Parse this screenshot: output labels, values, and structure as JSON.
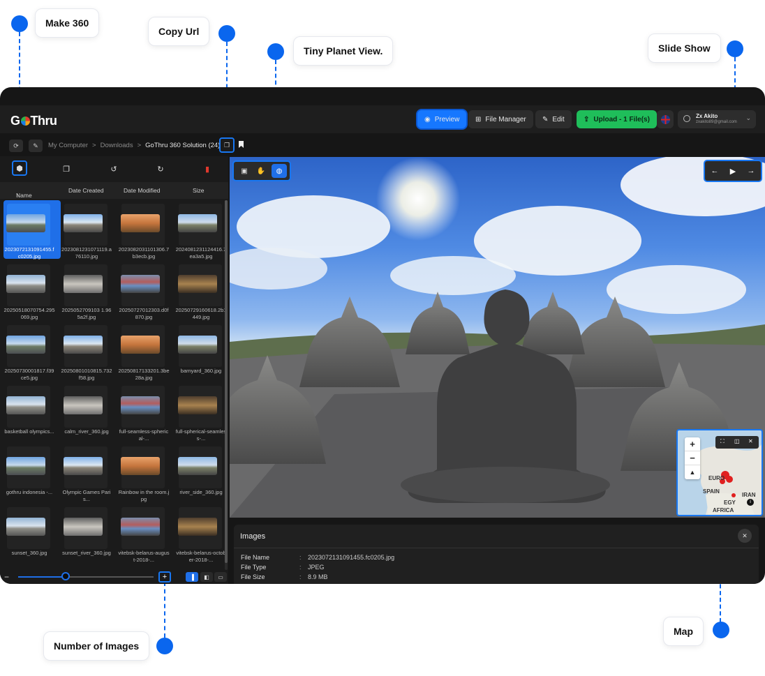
{
  "callouts": {
    "make360": "Make 360",
    "copy_url": "Copy Url",
    "tiny_planet": "Tiny Planet View.",
    "slide_show": "Slide Show",
    "number_of_images": "Number of Images",
    "map": "Map"
  },
  "app": {
    "logo": "GoThru",
    "header": {
      "preview": "Preview",
      "file_manager": "File Manager",
      "edit": "Edit",
      "upload": "Upload - 1 File(s)",
      "user_name": "Zx Akito",
      "user_email": "zxakito89@gmail.com"
    },
    "breadcrumb": {
      "items": [
        "My Computer",
        "Downloads"
      ],
      "current": "GoThru 360 Solution (24)",
      "separator": ">"
    },
    "columns": [
      "Name",
      "Date Created",
      "Date Modified",
      "Size"
    ],
    "sort_indicator": "↑",
    "files": [
      "2023072131091455.fc0205.jpg",
      "2023081231071119.a76110.jpg",
      "2023082031101306.7b3ecb.jpg",
      "2024081231124416.7ea3a5.jpg",
      "20250518070754.295069.jpg",
      "2025052709103 1.965a2f.jpg",
      "20250727012303.d0f870.jpg",
      "20250729160618.2b1449.jpg",
      "20250730001817.f39ce5.jpg",
      "20250801010815.732f58.jpg",
      "20250817133201.3be28a.jpg",
      "barnyard_360.jpg",
      "basketball olympics...",
      "calm_river_360.jpg",
      "full-seamless-spherical-...",
      "full-spherical-seamless-...",
      "gothru indonesia -...",
      "Olympic Games Paris...",
      "Rainbow in the room.jpg",
      "river_side_360.jpg",
      "sunset_360.jpg",
      "sunset_river_360.jpg",
      "vitebsk-belarus-august-2018-...",
      "vitebsk-belarus-october-2018-..."
    ],
    "info": {
      "title": "Images",
      "file_name_label": "File Name",
      "file_name": "2023072131091455.fc0205.jpg",
      "file_type_label": "File Type",
      "file_type": "JPEG",
      "file_size_label": "File Size",
      "file_size": "8.9 MB",
      "colon": ":"
    },
    "map": {
      "labels": [
        "EURO",
        "SPAIN",
        "EGY",
        "IRAN",
        "AFRICA"
      ]
    },
    "zoom_level": 0.35,
    "accent": "#1677ff",
    "upload_color": "#1fbe5a"
  }
}
